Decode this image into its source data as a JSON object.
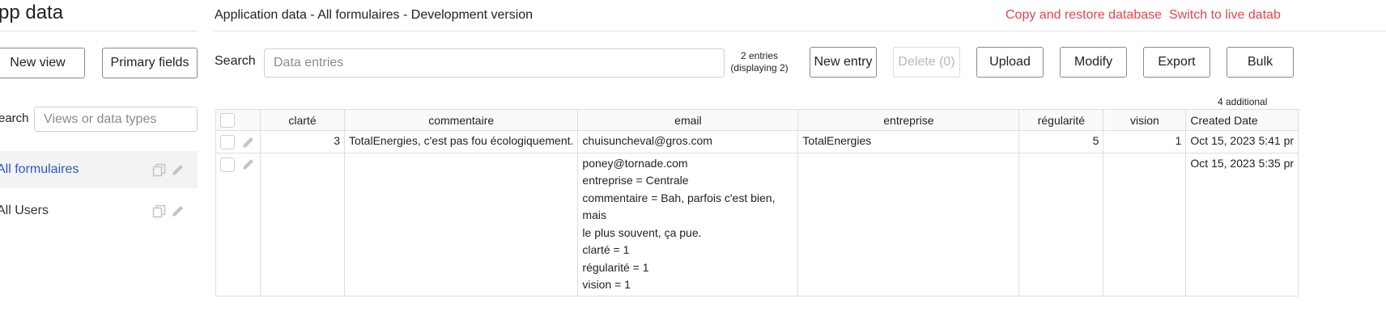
{
  "left": {
    "title": "pp data",
    "new_view_label": "New view",
    "primary_fields_label": "Primary fields",
    "search_label": "earch",
    "search_placeholder": "Views or data types",
    "items": [
      {
        "label": "All formulaires",
        "active": true
      },
      {
        "label": "All Users",
        "active": false
      }
    ]
  },
  "header": {
    "title": "Application data - All formulaires - Development version",
    "copy_restore_label": "Copy and restore database",
    "switch_live_label": "Switch to live datab"
  },
  "toolbar": {
    "search_label": "Search",
    "search_placeholder": "Data entries",
    "count_line1": "2 entries",
    "count_line2": "(displaying 2)",
    "new_entry_label": "New entry",
    "delete_label": "Delete (0)",
    "upload_label": "Upload",
    "modify_label": "Modify",
    "export_label": "Export",
    "bulk_label": "Bulk"
  },
  "table": {
    "additional_note": "4 additional",
    "columns": [
      "clarté",
      "commentaire",
      "email",
      "entreprise",
      "régularité",
      "vision",
      "Created Date"
    ],
    "rows": [
      {
        "clarte": "3",
        "commentaire": "TotalEnergies, c'est pas fou écologiquement.",
        "email_lines": [
          "chuisuncheval@gros.com"
        ],
        "entreprise": "TotalEnergies",
        "regularite": "5",
        "vision": "1",
        "created": "Oct 15, 2023 5:41 pr"
      },
      {
        "clarte": "",
        "commentaire": "",
        "email_lines": [
          "poney@tornade.com",
          "entreprise = Centrale",
          "commentaire = Bah, parfois c'est bien, mais",
          "le plus souvent, ça pue.",
          "clarté = 1",
          "régularité = 1",
          "vision = 1"
        ],
        "entreprise": "",
        "regularite": "",
        "vision": "",
        "created": "Oct 15, 2023 5:35 pr"
      }
    ]
  },
  "icons": {
    "copy": "copy-icon",
    "edit": "pencil-icon"
  }
}
